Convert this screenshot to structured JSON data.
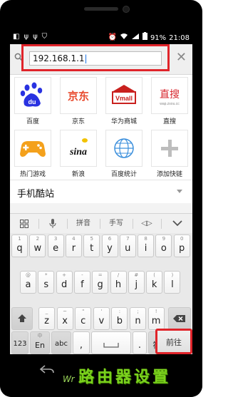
{
  "status_bar": {
    "battery": "91%",
    "time": "21:08",
    "left_icons": [
      "menu-icon",
      "usb-icon",
      "usb-icon",
      "shield-icon",
      "alarm-icon"
    ],
    "right_icons": [
      "wifi-icon",
      "signal-icon"
    ]
  },
  "address_bar": {
    "url": "192.168.1.1"
  },
  "tiles": [
    {
      "label": "百度",
      "logo": "du",
      "color": "#2932e1"
    },
    {
      "label": "京东",
      "logo": "京东",
      "color": "#e84b2e"
    },
    {
      "label": "华为商城",
      "logo": "Vmall",
      "color": "#c9201e"
    },
    {
      "label": "直搜",
      "logo": "直搜",
      "color": "#d7282f"
    },
    {
      "label": "热门游戏",
      "logo": "gamepad",
      "color": "#f4a11c"
    },
    {
      "label": "新浪",
      "logo": "sina",
      "color": "#d52b1e"
    },
    {
      "label": "百度统计",
      "logo": "globe",
      "color": "#3b8fdc"
    },
    {
      "label": "添加快链",
      "logo": "+",
      "color": "#bdbdbd"
    }
  ],
  "zhisou_sub": "wap.zsou.cc",
  "mobile_sites": "手机酷站",
  "ime_toolbar": {
    "pinyin": "拼音",
    "handwriting": "手写"
  },
  "keyboard": {
    "row1": [
      {
        "k": "q",
        "s": "1"
      },
      {
        "k": "w",
        "s": "2"
      },
      {
        "k": "e",
        "s": "3"
      },
      {
        "k": "r",
        "s": "4"
      },
      {
        "k": "t",
        "s": "5"
      },
      {
        "k": "y",
        "s": "6"
      },
      {
        "k": "u",
        "s": "7"
      },
      {
        "k": "i",
        "s": "8"
      },
      {
        "k": "o",
        "s": "9"
      },
      {
        "k": "p",
        "s": "0"
      }
    ],
    "row2": [
      {
        "k": "a",
        "s": "@"
      },
      {
        "k": "s",
        "s": "*"
      },
      {
        "k": "d",
        "s": "+"
      },
      {
        "k": "f",
        "s": "-"
      },
      {
        "k": "g",
        "s": "="
      },
      {
        "k": "h",
        "s": "/"
      },
      {
        "k": "j",
        "s": "#"
      },
      {
        "k": "k",
        "s": "("
      },
      {
        "k": "l",
        "s": ")"
      }
    ],
    "row3": [
      {
        "k": "z",
        "s": "_"
      },
      {
        "k": "x",
        "s": "~"
      },
      {
        "k": "c",
        "s": "\""
      },
      {
        "k": "v",
        "s": "'"
      },
      {
        "k": "b",
        "s": ":"
      },
      {
        "k": "n",
        "s": ";"
      },
      {
        "k": "m",
        "s": "!"
      }
    ],
    "key_123": "123",
    "key_lang_sup": "中",
    "key_lang": "En",
    "key_abc": "abc",
    "key_comma": ",",
    "key_punct_sup": "?",
    "key_punct": "符",
    "key_go": "前往",
    "key_space_sup": ""
  },
  "watermark": {
    "text": "路由器设置",
    "logo": "Wr"
  }
}
